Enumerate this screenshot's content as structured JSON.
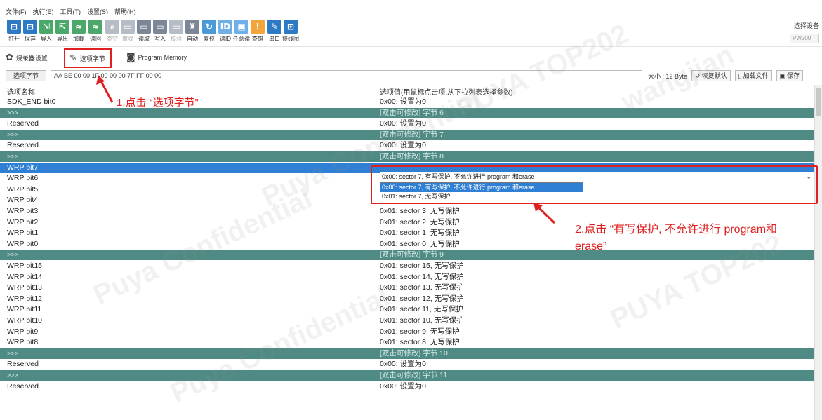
{
  "menu": [
    "文件(F)",
    "执行(E)",
    "工具(T)",
    "设置(S)",
    "帮助(H)"
  ],
  "toolbar": [
    {
      "label": "打开",
      "icon": "folder-icon",
      "glyph": "⊟",
      "color": "blue",
      "enabled": true
    },
    {
      "label": "保存",
      "icon": "save-icon",
      "glyph": "⊟",
      "color": "blue",
      "enabled": true
    },
    {
      "label": "导入",
      "icon": "import-icon",
      "glyph": "⇲",
      "color": "green",
      "enabled": true
    },
    {
      "label": "导出",
      "icon": "export-icon",
      "glyph": "⇱",
      "color": "green",
      "enabled": true
    },
    {
      "label": "加载",
      "icon": "load-icon",
      "glyph": "≈",
      "color": "green",
      "enabled": true
    },
    {
      "label": "读回",
      "icon": "readback-icon",
      "glyph": "≈",
      "color": "green",
      "enabled": true
    },
    {
      "label": "查空",
      "icon": "blank-check-icon",
      "glyph": "⌕",
      "color": "gray",
      "enabled": false
    },
    {
      "label": "擦除",
      "icon": "erase-icon",
      "glyph": "▭",
      "color": "gray",
      "enabled": false
    },
    {
      "label": "读取",
      "icon": "read-icon",
      "glyph": "▭",
      "color": "gray",
      "enabled": true
    },
    {
      "label": "写入",
      "icon": "write-icon",
      "glyph": "▭",
      "color": "gray",
      "enabled": true
    },
    {
      "label": "校验",
      "icon": "verify-icon",
      "glyph": "▭",
      "color": "gray",
      "enabled": false
    },
    {
      "label": "自动",
      "icon": "auto-icon",
      "glyph": "♜",
      "color": "gray",
      "enabled": true
    },
    {
      "label": "复位",
      "icon": "reset-icon",
      "glyph": "↻",
      "color": "lblue",
      "enabled": true
    },
    {
      "label": "读ID",
      "icon": "read-id-icon",
      "glyph": "ID",
      "color": "lblue2",
      "enabled": true
    },
    {
      "label": "任意读",
      "icon": "random-read-icon",
      "glyph": "▣",
      "color": "lblue2",
      "enabled": true
    },
    {
      "label": "查错",
      "icon": "debug-icon",
      "glyph": "!",
      "color": "orange",
      "enabled": true
    },
    {
      "label": "串口",
      "icon": "serial-port-icon",
      "glyph": "✎",
      "color": "blue",
      "enabled": true
    },
    {
      "label": "接线图",
      "icon": "wiring-diagram-icon",
      "glyph": "⊞",
      "color": "blue",
      "enabled": true
    }
  ],
  "device": {
    "label": "选择设备",
    "value": "PW200"
  },
  "tabs": [
    {
      "label": "烧录器设置",
      "icon": "gear-icon",
      "glyph": "✿"
    },
    {
      "label": "选项字节",
      "icon": "option-bytes-icon",
      "glyph": "✎"
    },
    {
      "label": "Program Memory",
      "icon": "memory-icon",
      "glyph": "◙"
    }
  ],
  "optionbar": {
    "label": "选项字节",
    "value": "AA BE 00 00 1F 00 00 00 7F FF 00 00",
    "size": "大小 : 12 Byte",
    "restore": "恢复默认",
    "loadfile": "加载文件",
    "save": "保存"
  },
  "grid": {
    "col1": "选项名称",
    "col2": "选项值(用鼠标点击项,从下拉列表选择参数)",
    "rows": [
      {
        "name": "SDK_END bit0",
        "value": "0x00: 设置为0",
        "type": "item"
      },
      {
        "name": ">>>",
        "value": "[双击可修改] 字节 6",
        "type": "sep"
      },
      {
        "name": "Reserved",
        "value": "0x00: 设置为0",
        "type": "item"
      },
      {
        "name": ">>>",
        "value": "[双击可修改] 字节 7",
        "type": "sep"
      },
      {
        "name": "Reserved",
        "value": "0x00: 设置为0",
        "type": "item"
      },
      {
        "name": ">>>",
        "value": "[双击可修改] 字节 8",
        "type": "sep"
      },
      {
        "name": "WRP bit7",
        "value": "",
        "type": "sel"
      },
      {
        "name": "WRP bit6",
        "value": "",
        "type": "item"
      },
      {
        "name": "WRP bit5",
        "value": "",
        "type": "item"
      },
      {
        "name": "WRP bit4",
        "value": "0x01: sector 4, 无写保护",
        "type": "item"
      },
      {
        "name": "WRP bit3",
        "value": "0x01: sector 3, 无写保护",
        "type": "item"
      },
      {
        "name": "WRP bit2",
        "value": "0x01: sector 2, 无写保护",
        "type": "item"
      },
      {
        "name": "WRP bit1",
        "value": "0x01: sector 1, 无写保护",
        "type": "item"
      },
      {
        "name": "WRP bit0",
        "value": "0x01: sector 0, 无写保护",
        "type": "item"
      },
      {
        "name": ">>>",
        "value": "[双击可修改] 字节 9",
        "type": "sep"
      },
      {
        "name": "WRP bit15",
        "value": "0x01: sector 15, 无写保护",
        "type": "item"
      },
      {
        "name": "WRP bit14",
        "value": "0x01: sector 14, 无写保护",
        "type": "item"
      },
      {
        "name": "WRP bit13",
        "value": "0x01: sector 13, 无写保护",
        "type": "item"
      },
      {
        "name": "WRP bit12",
        "value": "0x01: sector 12, 无写保护",
        "type": "item"
      },
      {
        "name": "WRP bit11",
        "value": "0x01: sector 11, 无写保护",
        "type": "item"
      },
      {
        "name": "WRP bit10",
        "value": "0x01: sector 10, 无写保护",
        "type": "item"
      },
      {
        "name": "WRP bit9",
        "value": "0x01: sector 9, 无写保护",
        "type": "item"
      },
      {
        "name": "WRP bit8",
        "value": "0x01: sector 8, 无写保护",
        "type": "item"
      },
      {
        "name": ">>>",
        "value": "[双击可修改] 字节 10",
        "type": "sep"
      },
      {
        "name": "Reserved",
        "value": "0x00: 设置为0",
        "type": "item"
      },
      {
        "name": ">>>",
        "value": "[双击可修改] 字节 11",
        "type": "sep"
      },
      {
        "name": "Reserved",
        "value": "0x00: 设置为0",
        "type": "item"
      }
    ]
  },
  "combo": {
    "value": "0x00: sector 7, 有写保护, 不允许进行 program 和erase",
    "options": [
      {
        "text": "0x00: sector 7, 有写保护, 不允许进行 program 和erase",
        "highlighted": true
      },
      {
        "text": "0x01: sector 7, 无写保护",
        "highlighted": false
      }
    ]
  },
  "annotations": {
    "step1": "1.点击 “选项字节”",
    "step2": "2.点击 “有写保护, 不允许进行 program和erase”",
    "color": "#e02020"
  },
  "watermarks": [
    "Puya Confidential",
    "PUYA TOP202",
    "wangjian"
  ],
  "colors": {
    "separator": "#4f8a84",
    "selected": "#2f7fd4",
    "annotation": "#e02020"
  }
}
